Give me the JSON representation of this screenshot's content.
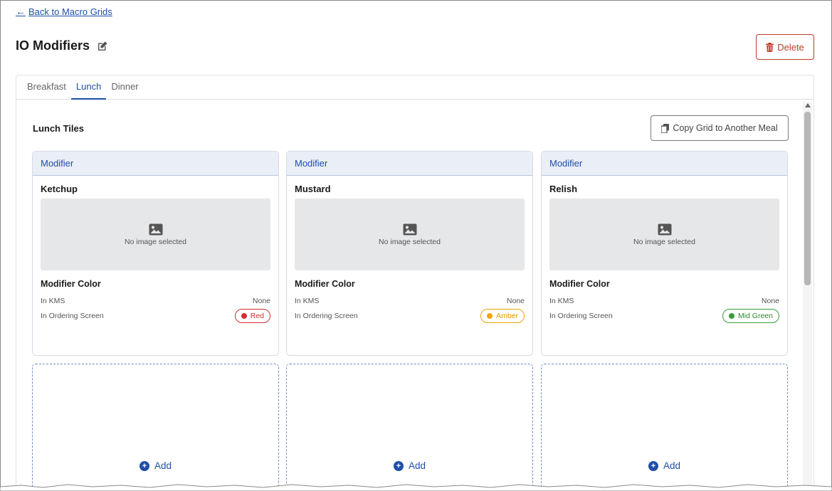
{
  "back_link": {
    "label": "Back to Macro Grids"
  },
  "page": {
    "title": "IO Modifiers"
  },
  "delete_button": {
    "label": "Delete"
  },
  "tabs": [
    {
      "label": "Breakfast",
      "active": false
    },
    {
      "label": "Lunch",
      "active": true
    },
    {
      "label": "Dinner",
      "active": false
    }
  ],
  "section": {
    "title": "Lunch Tiles",
    "copy_button_label": "Copy Grid to Another Meal"
  },
  "tiles": [
    {
      "type_label": "Modifier",
      "name": "Ketchup",
      "image_placeholder": "No image selected",
      "color_title": "Modifier Color",
      "kms_label": "In KMS",
      "kms_value": "None",
      "ordering_label": "In Ordering Screen",
      "ordering_value": "Red",
      "ordering_color": "#d32f2f"
    },
    {
      "type_label": "Modifier",
      "name": "Mustard",
      "image_placeholder": "No image selected",
      "color_title": "Modifier Color",
      "kms_label": "In KMS",
      "kms_value": "None",
      "ordering_label": "In Ordering Screen",
      "ordering_value": "Amber",
      "ordering_color": "#f0a500"
    },
    {
      "type_label": "Modifier",
      "name": "Relish",
      "image_placeholder": "No image selected",
      "color_title": "Modifier Color",
      "kms_label": "In KMS",
      "kms_value": "None",
      "ordering_label": "In Ordering Screen",
      "ordering_value": "Mid Green",
      "ordering_color": "#3a9a3a"
    }
  ],
  "add_tiles": [
    {
      "label": "Add"
    },
    {
      "label": "Add"
    },
    {
      "label": "Add"
    }
  ],
  "colors": {
    "accent": "#1f4fa8",
    "danger": "#c0392b"
  }
}
